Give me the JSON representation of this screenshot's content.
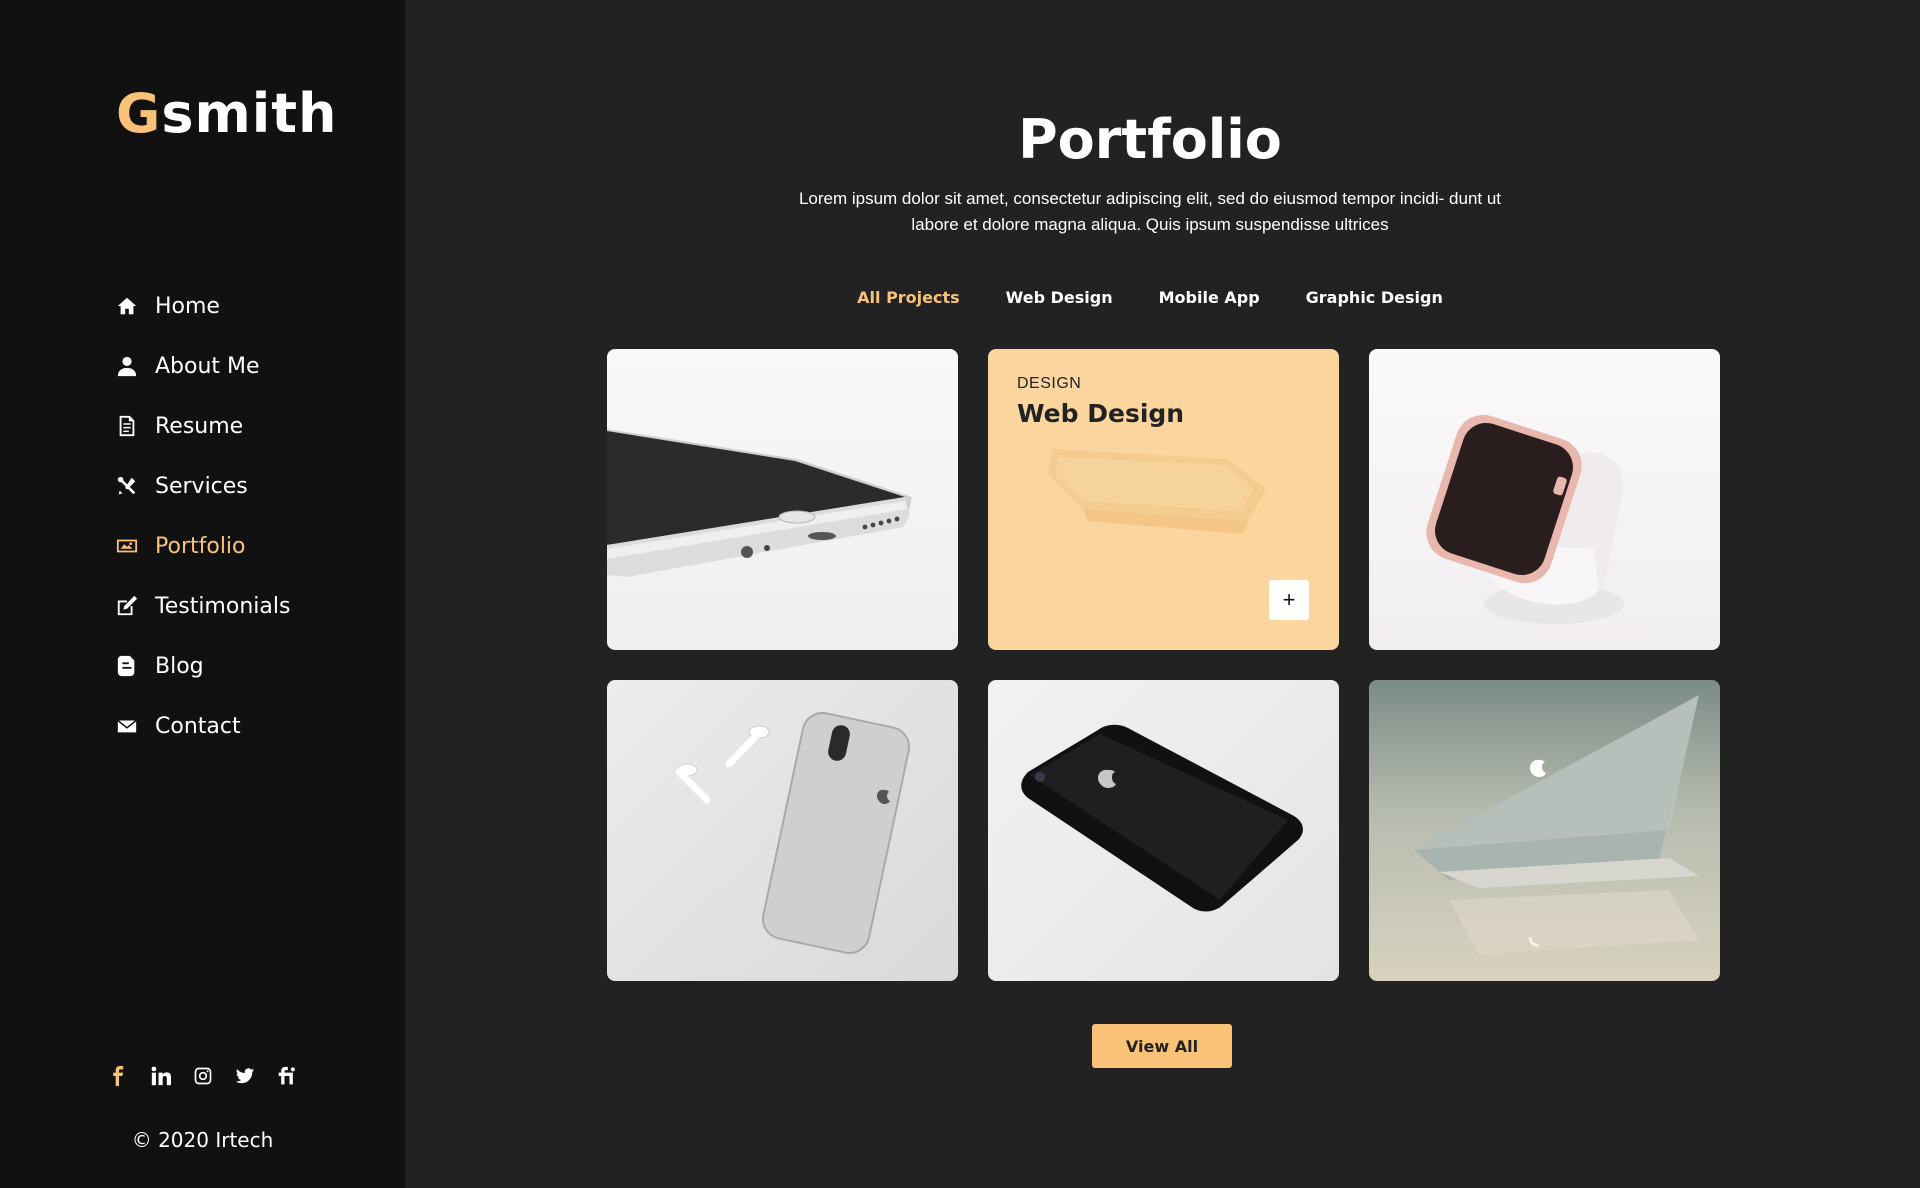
{
  "logo": {
    "first_letter": "G",
    "rest": "smith"
  },
  "nav": {
    "items": [
      {
        "label": "Home",
        "icon": "home-icon"
      },
      {
        "label": "About Me",
        "icon": "user-icon"
      },
      {
        "label": "Resume",
        "icon": "resume-icon"
      },
      {
        "label": "Services",
        "icon": "tools-icon"
      },
      {
        "label": "Portfolio",
        "icon": "portfolio-icon",
        "active": true
      },
      {
        "label": "Testimonials",
        "icon": "edit-icon"
      },
      {
        "label": "Blog",
        "icon": "blog-icon"
      },
      {
        "label": "Contact",
        "icon": "envelope-icon"
      }
    ]
  },
  "social": [
    "facebook-icon",
    "linkedin-icon",
    "instagram-icon",
    "twitter-icon",
    "fiverr-icon"
  ],
  "copyright": "© 2020 Irtech",
  "main": {
    "title": "Portfolio",
    "description": "Lorem ipsum dolor sit amet, consectetur adipiscing elit, sed do eiusmod tempor incidi- dunt ut labore et dolore magna aliqua. Quis ipsum suspendisse ultrices",
    "filters": [
      {
        "label": "All Projects",
        "active": true
      },
      {
        "label": "Web Design"
      },
      {
        "label": "Mobile App"
      },
      {
        "label": "Graphic Design"
      }
    ],
    "hover_card": {
      "category": "DESIGN",
      "title": "Web Design",
      "plus": "+"
    },
    "view_all": "View All"
  },
  "colors": {
    "accent": "#f9c277",
    "sidebar_bg": "#111111",
    "main_bg": "#222222"
  }
}
